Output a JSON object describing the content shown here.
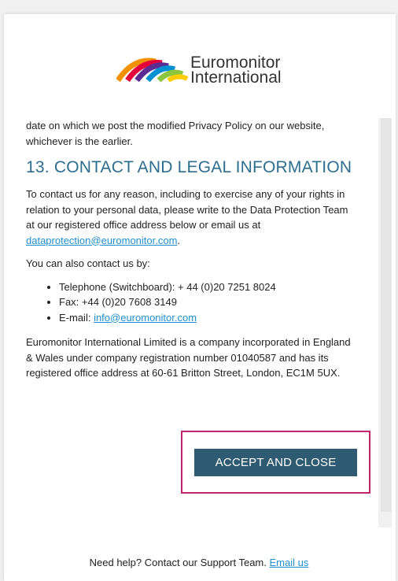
{
  "logo": {
    "line1": "Euromonitor",
    "line2": "International",
    "colors": [
      "#f39200",
      "#e4003a",
      "#0090d4",
      "#5c2d91",
      "#8cc63f",
      "#ffcc00"
    ]
  },
  "content": {
    "intro_text": "date on which we post the modified Privacy Policy on our website, whichever is the earlier.",
    "section_title": "13. CONTACT AND LEGAL INFORMATION",
    "para1_text": "To contact us for any reason, including to exercise any of your rights in relation to your personal data, please write to the Data Protection Team at our registered office address below or email us at ",
    "para1_link": "dataprotection@euromonitor.com",
    "para1_end": ".",
    "para2_text": "You can also contact us by:",
    "contact_items": {
      "telephone": "Telephone (Switchboard): + 44 (0)20 7251 8024",
      "fax": "Fax: +44 (0)20 7608 3149",
      "email_label": "E-mail: ",
      "email_link": "info@euromonitor.com"
    },
    "para3_text": "Euromonitor International Limited is a company incorporated in England & Wales under company registration number 01040587 and has its registered office address at 60-61 Britton Street, London, EC1M 5UX."
  },
  "button": {
    "accept_label": "ACCEPT AND CLOSE",
    "highlight_color": "#c0256e",
    "bg_color": "#2e5b72"
  },
  "footer": {
    "help_text": "Need help? Contact our Support Team. ",
    "help_link": "Email us"
  },
  "colors": {
    "heading": "#2c6e8f",
    "link": "#1f8fcf"
  }
}
